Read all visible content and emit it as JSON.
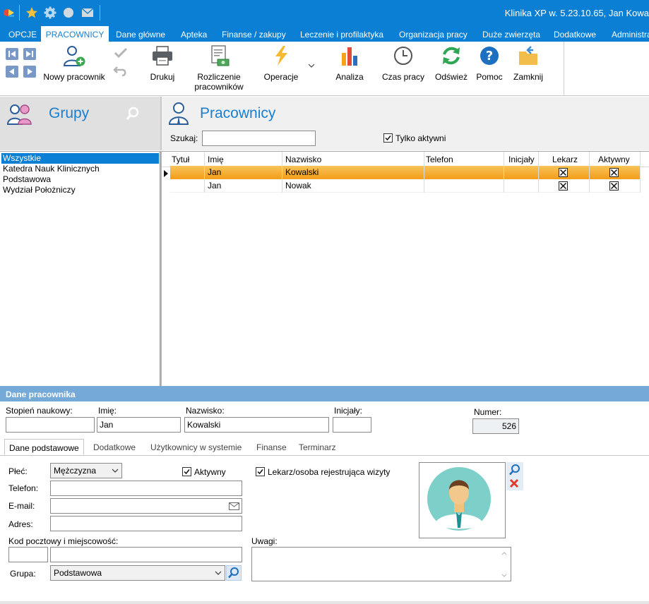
{
  "app": {
    "title": "Klinika XP w. 5.23.10.65, Jan Kowa"
  },
  "menu": {
    "tabs": [
      {
        "label": "OPCJE"
      },
      {
        "label": "PRACOWNICY"
      },
      {
        "label": "Dane główne"
      },
      {
        "label": "Apteka"
      },
      {
        "label": "Finanse / zakupy"
      },
      {
        "label": "Leczenie i profilaktyka"
      },
      {
        "label": "Organizacja pracy"
      },
      {
        "label": "Duże zwierzęta"
      },
      {
        "label": "Dodatkowe"
      },
      {
        "label": "Administra"
      }
    ]
  },
  "ribbon": {
    "new_employee": "Nowy pracownik",
    "print": "Drukuj",
    "settlement_line1": "Rozliczenie",
    "settlement_line2": "pracowników",
    "operations": "Operacje",
    "analysis": "Analiza",
    "work_time": "Czas pracy",
    "refresh": "Odśwież",
    "help": "Pomoc",
    "close": "Zamknij"
  },
  "groups": {
    "title": "Grupy",
    "items": [
      {
        "label": "Wszystkie"
      },
      {
        "label": "Katedra Nauk Klinicznych"
      },
      {
        "label": "Podstawowa"
      },
      {
        "label": "Wydział Położniczy"
      }
    ]
  },
  "employees": {
    "title": "Pracownicy",
    "search_label": "Szukaj:",
    "search_value": "",
    "only_active_label": "Tylko aktywni",
    "only_active_checked": true,
    "columns": [
      "Tytuł",
      "Imię",
      "Nazwisko",
      "Telefon",
      "Inicjały",
      "Lekarz",
      "Aktywny"
    ],
    "rows": [
      {
        "title": "",
        "first": "Jan",
        "last": "Kowalski",
        "phone": "",
        "initials": "",
        "doctor": true,
        "active": true
      },
      {
        "title": "",
        "first": "Jan",
        "last": "Nowak",
        "phone": "",
        "initials": "",
        "doctor": true,
        "active": true
      }
    ]
  },
  "details": {
    "header": "Dane pracownika",
    "degree_label": "Stopień naukowy:",
    "degree_value": "",
    "first_label": "Imię:",
    "first_value": "Jan",
    "last_label": "Nazwisko:",
    "last_value": "Kowalski",
    "initials_label": "Inicjały:",
    "initials_value": "",
    "number_label": "Numer:",
    "number_value": "526",
    "tabs": [
      {
        "label": "Dane podstawowe"
      },
      {
        "label": "Dodatkowe"
      },
      {
        "label": "Użytkownicy w systemie"
      },
      {
        "label": "Finanse"
      },
      {
        "label": "Terminarz"
      }
    ],
    "gender_label": "Płeć:",
    "gender_value": "Mężczyzna",
    "active_label": "Aktywny",
    "doctor_label": "Lekarz/osoba rejestrująca wizyty",
    "phone_label": "Telefon:",
    "phone_value": "",
    "email_label": "E-mail:",
    "email_value": "",
    "address_label": "Adres:",
    "address_value": "",
    "postal_label": "Kod pocztowy i miejscowość:",
    "postal_value": "",
    "city_value": "",
    "group_label": "Grupa:",
    "group_value": "Podstawowa",
    "notes_label": "Uwagi:",
    "notes_value": ""
  },
  "colors": {
    "accent": "#0a7fd3",
    "row_selected": "#f5a31a",
    "header_blue": "#75a9d8"
  }
}
